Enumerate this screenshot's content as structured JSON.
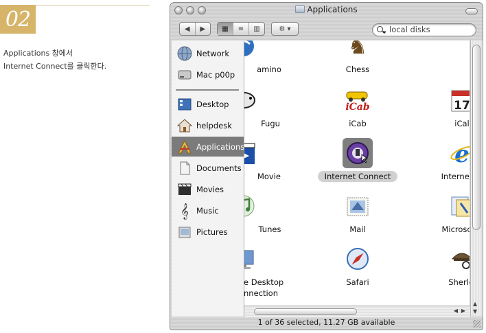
{
  "step": {
    "number": "02"
  },
  "caption": {
    "line1": "Applications 창에서",
    "line2": "Internet Connect를 클릭한다."
  },
  "window": {
    "title": "Applications",
    "search_placeholder": "local disks",
    "status": "1 of 36 selected, 11.27 GB available"
  },
  "toolbar": {
    "back": "◀",
    "forward": "▶",
    "view_icon": "▦",
    "view_list": "≡",
    "view_column": "▥",
    "action": "⚙ ▾"
  },
  "sidebar": {
    "items": [
      {
        "label": "Network",
        "icon": "globe-icon"
      },
      {
        "label": "Mac p00p",
        "icon": "hard-drive-icon"
      },
      {
        "label": "Desktop",
        "icon": "desktop-icon"
      },
      {
        "label": "helpdesk",
        "icon": "home-icon"
      },
      {
        "label": "Applications",
        "icon": "applications-icon",
        "selected": true
      },
      {
        "label": "Documents",
        "icon": "documents-icon"
      },
      {
        "label": "Movies",
        "icon": "movies-icon"
      },
      {
        "label": "Music",
        "icon": "music-icon"
      },
      {
        "label": "Pictures",
        "icon": "pictures-icon"
      }
    ]
  },
  "apps": [
    {
      "label": "amino",
      "icon": "camino-icon"
    },
    {
      "label": "Chess",
      "icon": "chess-icon"
    },
    {
      "label": "Fugu",
      "icon": "fugu-icon"
    },
    {
      "label": "iCab",
      "icon": "icab-icon"
    },
    {
      "label": "iCal",
      "icon": "ical-icon"
    },
    {
      "label": "Movie",
      "icon": "imovie-icon"
    },
    {
      "label": "Internet Connect",
      "icon": "internet-connect-icon",
      "selected": true
    },
    {
      "label": "Internet Exp",
      "icon": "internet-explorer-icon"
    },
    {
      "label": "Tunes",
      "icon": "itunes-icon"
    },
    {
      "label": "Mail",
      "icon": "mail-icon"
    },
    {
      "label": "Microsoft Of",
      "icon": "microsoft-office-icon"
    },
    {
      "label": "e Desktop",
      "label2": "nnection",
      "icon": "remote-desktop-icon"
    },
    {
      "label": "Safari",
      "icon": "safari-icon"
    },
    {
      "label": "Sherlock",
      "icon": "sherlock-icon"
    }
  ],
  "colors": {
    "accent": "#d6b56a",
    "sidebar_selected": "#7b7b7b",
    "ie_blue": "#1a6fd1"
  }
}
